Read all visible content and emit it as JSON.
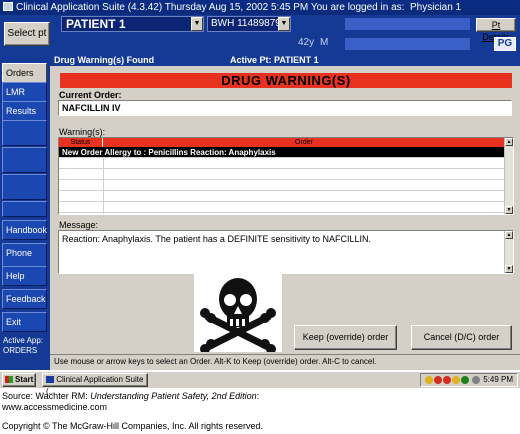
{
  "window": {
    "title": "Clinical Application Suite  (4.3.42)  Thursday  Aug 15, 2002 5:45 PM   You are logged in as:",
    "user": "Physician 1"
  },
  "header": {
    "select_pt_label": "Select pt",
    "patient_name": "PATIENT 1",
    "mrn": "BWH 11489879",
    "age": "42y",
    "sex": "M",
    "pt_details_label": "Pt Details",
    "logo_text": "PG"
  },
  "sidebar": {
    "items": [
      {
        "label": "Orders"
      },
      {
        "label": "LMR"
      },
      {
        "label": "Results"
      },
      {
        "label": ""
      },
      {
        "label": ""
      },
      {
        "label": ""
      },
      {
        "label": ""
      },
      {
        "label": "Handbook"
      },
      {
        "label": "Phone Dir"
      },
      {
        "label": "Help"
      },
      {
        "label": "Feedback"
      },
      {
        "label": "Exit"
      }
    ],
    "active_app_label": "Active App:",
    "active_app_value": "ORDERS"
  },
  "main": {
    "strip_found": "Drug Warning(s) Found",
    "strip_active": "Active Pt:  PATIENT 1",
    "banner": "DRUG WARNING(S)",
    "current_order_label": "Current Order:",
    "current_order": "NAFCILLIN     IV",
    "warnings_label": "Warning(s):",
    "table": {
      "headers": [
        "Status",
        "Order"
      ],
      "rows": [
        {
          "text": "New Order  Allergy to : Penicillins  Reaction: Anaphylaxis"
        }
      ]
    },
    "message_label": "Message:",
    "message": "Reaction: Anaphylaxis. The patient has a DEFINITE sensitivity to NAFCILLIN.",
    "keep_button": "Keep (override) order",
    "cancel_button": "Cancel (D/C) order",
    "hint": "Use mouse or arrow keys to select an Order.  Alt-K to Keep (override) order.  Alt-C to cancel."
  },
  "taskbar": {
    "start_label": "Start",
    "task_label": "Clinical Application Suite (...",
    "clock": "5:49 PM"
  },
  "caption": {
    "source_prefix": "Source: Wachter RM: ",
    "source_title": "Understanding Patient Safety, 2nd Edition",
    "source_suffix": ":",
    "url": "www.accessmedicine.com",
    "copyright": "Copyright © The McGraw-Hill Companies, Inc. All rights reserved."
  }
}
